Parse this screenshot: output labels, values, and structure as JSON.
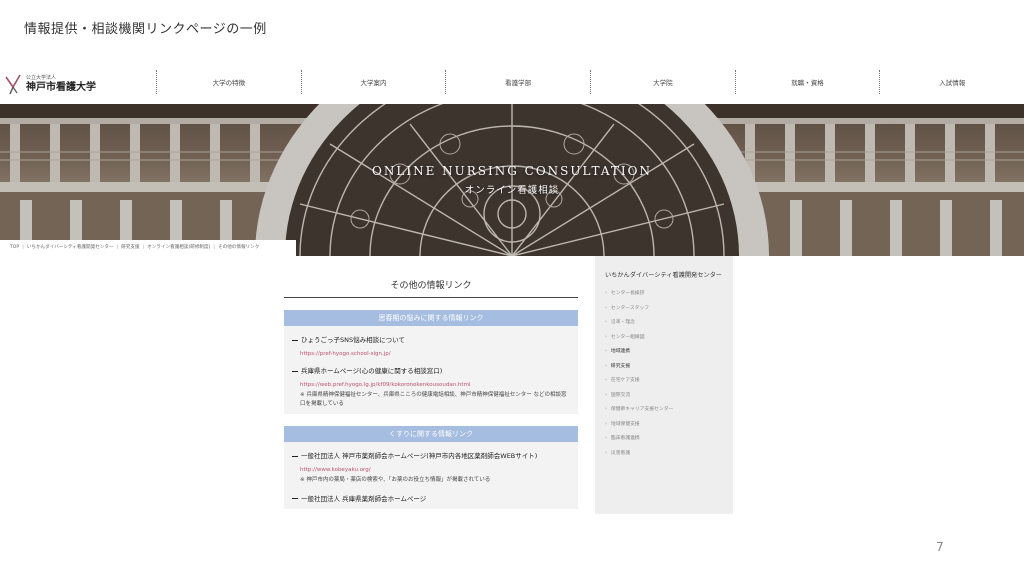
{
  "slide": {
    "title": "情報提供・相談機関リンクページの一例",
    "page_number": "7"
  },
  "header": {
    "logo_small": "公立大学法人",
    "logo_name": "神戸市看護大学",
    "nav": [
      "大学の特徴",
      "大学案内",
      "看護学部",
      "大学院",
      "就職・資格",
      "入試情報"
    ]
  },
  "hero": {
    "title": "ONLINE NURSING CONSULTATION",
    "subtitle": "オンライン看護相談"
  },
  "breadcrumb": [
    "TOP",
    "いちかんダイバーシティ看護開発センター",
    "研究支援",
    "オンライン看護相談(研修制度)",
    "その他の情報リンク"
  ],
  "main": {
    "heading": "その他の情報リンク",
    "sections": [
      {
        "bar": "思春期の悩みに関する情報リンク",
        "entries": [
          {
            "title": "ひょうごっ子SNS悩み相談について",
            "url": "https://pref-hyogo.school-sign.jp/",
            "note": ""
          },
          {
            "title": "兵庫県ホームページ(心の健康に関する相談窓口)",
            "url": "https://web.pref.hyogo.lg.jp/kf09/kokoronokenkousoudan.html",
            "note": "※ 兵庫県精神保健福祉センター、兵庫県こころの健康電話相談、神戸市精神保健福祉センター などの相談窓口を掲載している"
          }
        ]
      },
      {
        "bar": "くすりに関する情報リンク",
        "entries": [
          {
            "title": "一般社団法人 神戸市薬剤師会ホームページ(神戸市内各地区薬剤師会WEBサイト)",
            "url": "http://www.kobeyaku.org/",
            "note": "※ 神戸市内の薬局・薬店の検索や、「お薬のお役立ち情報」が掲載されている"
          },
          {
            "title": "一般社団法人 兵庫県薬剤師会ホームページ",
            "url": "",
            "note": ""
          }
        ]
      }
    ]
  },
  "sidebar": {
    "title": "いちかんダイバーシティ看護開発センター",
    "items": [
      "センター長挨拶",
      "センタースタッフ",
      "沿革・理念",
      "センター組織図",
      "地域連携",
      "研究支援",
      "在宅ケア支援",
      "国際交流",
      "保健師キャリア支援センター",
      "地域保健支援",
      "臨床看護連携",
      "災害看護"
    ],
    "active_items": [
      4,
      5
    ]
  }
}
